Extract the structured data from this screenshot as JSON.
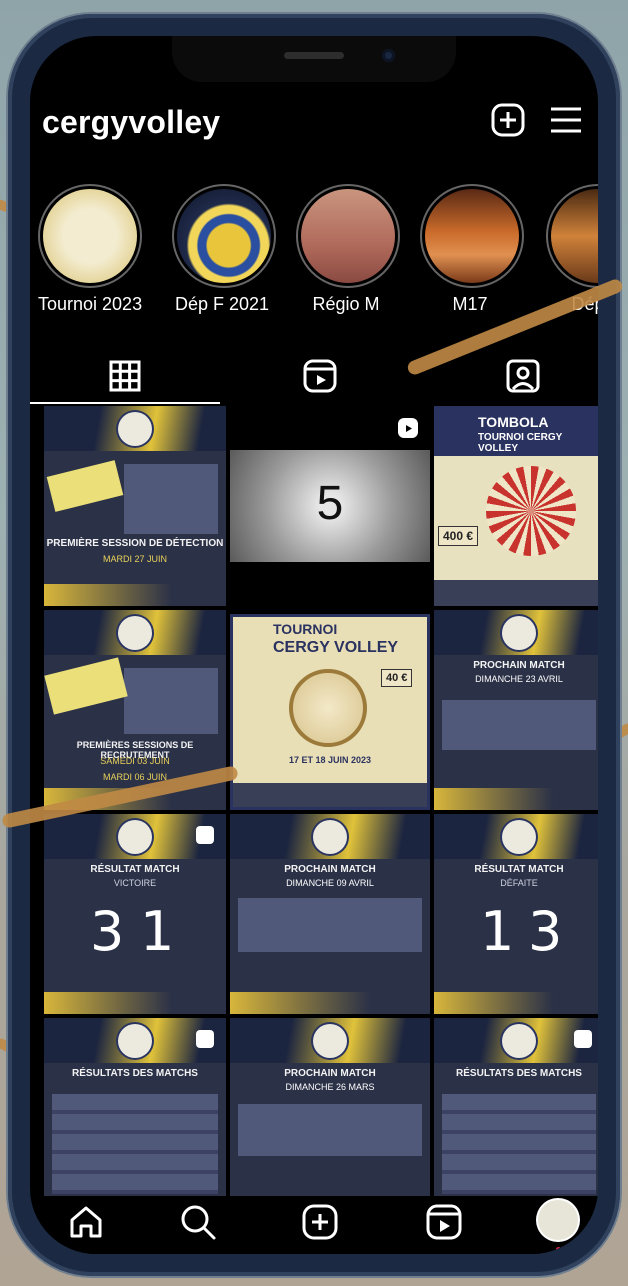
{
  "profile": {
    "username": "cergyvolley"
  },
  "highlights": [
    {
      "label": "Tournoi 2023"
    },
    {
      "label": "Dép F 2021"
    },
    {
      "label": "Régio M"
    },
    {
      "label": "M17"
    },
    {
      "label": "Dép F"
    }
  ],
  "posts": {
    "p1": {
      "title": "PREMIÈRE SESSION DE DÉTECTION",
      "sub": "MARDI 27 JUIN"
    },
    "p2": {
      "countdown": "5"
    },
    "p3": {
      "title": "TOMBOLA",
      "sub": "TOURNOI CERGY VOLLEY",
      "price": "400 €"
    },
    "p4": {
      "title": "PREMIÈRES SESSIONS DE RECRUTEMENT",
      "sub": "SAMEDI 03 JUIN",
      "sub2": "MARDI 06 JUIN"
    },
    "p5": {
      "title": "TOURNOI",
      "sub": "CERGY VOLLEY",
      "price": "40 €",
      "date": "17 ET 18 JUIN 2023"
    },
    "p6": {
      "title": "PROCHAIN MATCH",
      "sub": "DIMANCHE 23 AVRIL"
    },
    "p7": {
      "title": "RÉSULTAT MATCH",
      "sub": "VICTOIRE",
      "score_left": "3",
      "score_right": "1"
    },
    "p8": {
      "title": "PROCHAIN MATCH",
      "sub": "DIMANCHE 09 AVRIL"
    },
    "p9": {
      "title": "RÉSULTAT MATCH",
      "sub": "DÉFAITE",
      "score_left": "1",
      "score_right": "3"
    },
    "p10": {
      "title": "RÉSULTATS DES MATCHS"
    },
    "p11": {
      "title": "PROCHAIN MATCH",
      "sub": "DIMANCHE 26 MARS"
    },
    "p12": {
      "title": "RÉSULTATS DES MATCHS"
    }
  },
  "icons": {
    "new_post": "plus-square-icon",
    "menu": "hamburger-menu-icon",
    "grid_tab": "grid-icon",
    "reels_tab": "reels-icon",
    "tagged_tab": "tagged-person-icon",
    "nav": [
      "home-icon",
      "search-icon",
      "add-icon",
      "reels-icon",
      "profile-avatar"
    ]
  },
  "colors": {
    "background": "#000000",
    "accent_gold": "#e0c23a",
    "navy": "#1c2540",
    "annotation_brown": "#c08a45"
  }
}
